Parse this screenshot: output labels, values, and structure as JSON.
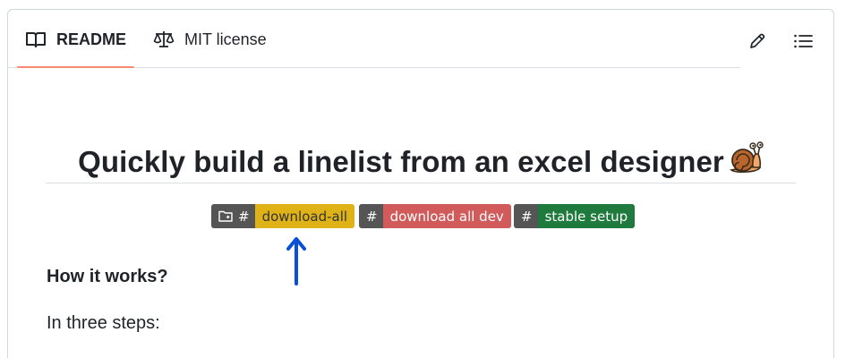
{
  "tabs": [
    {
      "label": "README",
      "icon": "book-icon",
      "active": true
    },
    {
      "label": "MIT license",
      "icon": "law-scale-icon",
      "active": false
    }
  ],
  "toolbar": {
    "edit_icon": "pencil-icon",
    "outline_icon": "list-unordered-icon"
  },
  "readme": {
    "title": "Quickly build a linelist from an excel designer",
    "title_emoji": "snail-icon",
    "badges": [
      {
        "label": "#",
        "value": "download-all",
        "label_icon": "folder-icon",
        "value_color": "#dfb317"
      },
      {
        "label": "#",
        "value": "download all dev",
        "value_color": "#d15b5b"
      },
      {
        "label": "#",
        "value": "stable setup",
        "value_color": "#1f7a3d"
      }
    ],
    "section_heading": "How it works?",
    "paragraph": "In three steps:"
  },
  "annotation": {
    "arrow_color": "#0a4fd8",
    "arrow_icon": "arrow-up-icon"
  },
  "colors": {
    "tab_underline": "#fd8c73",
    "text": "#1f2328",
    "border": "#d0d7de"
  }
}
